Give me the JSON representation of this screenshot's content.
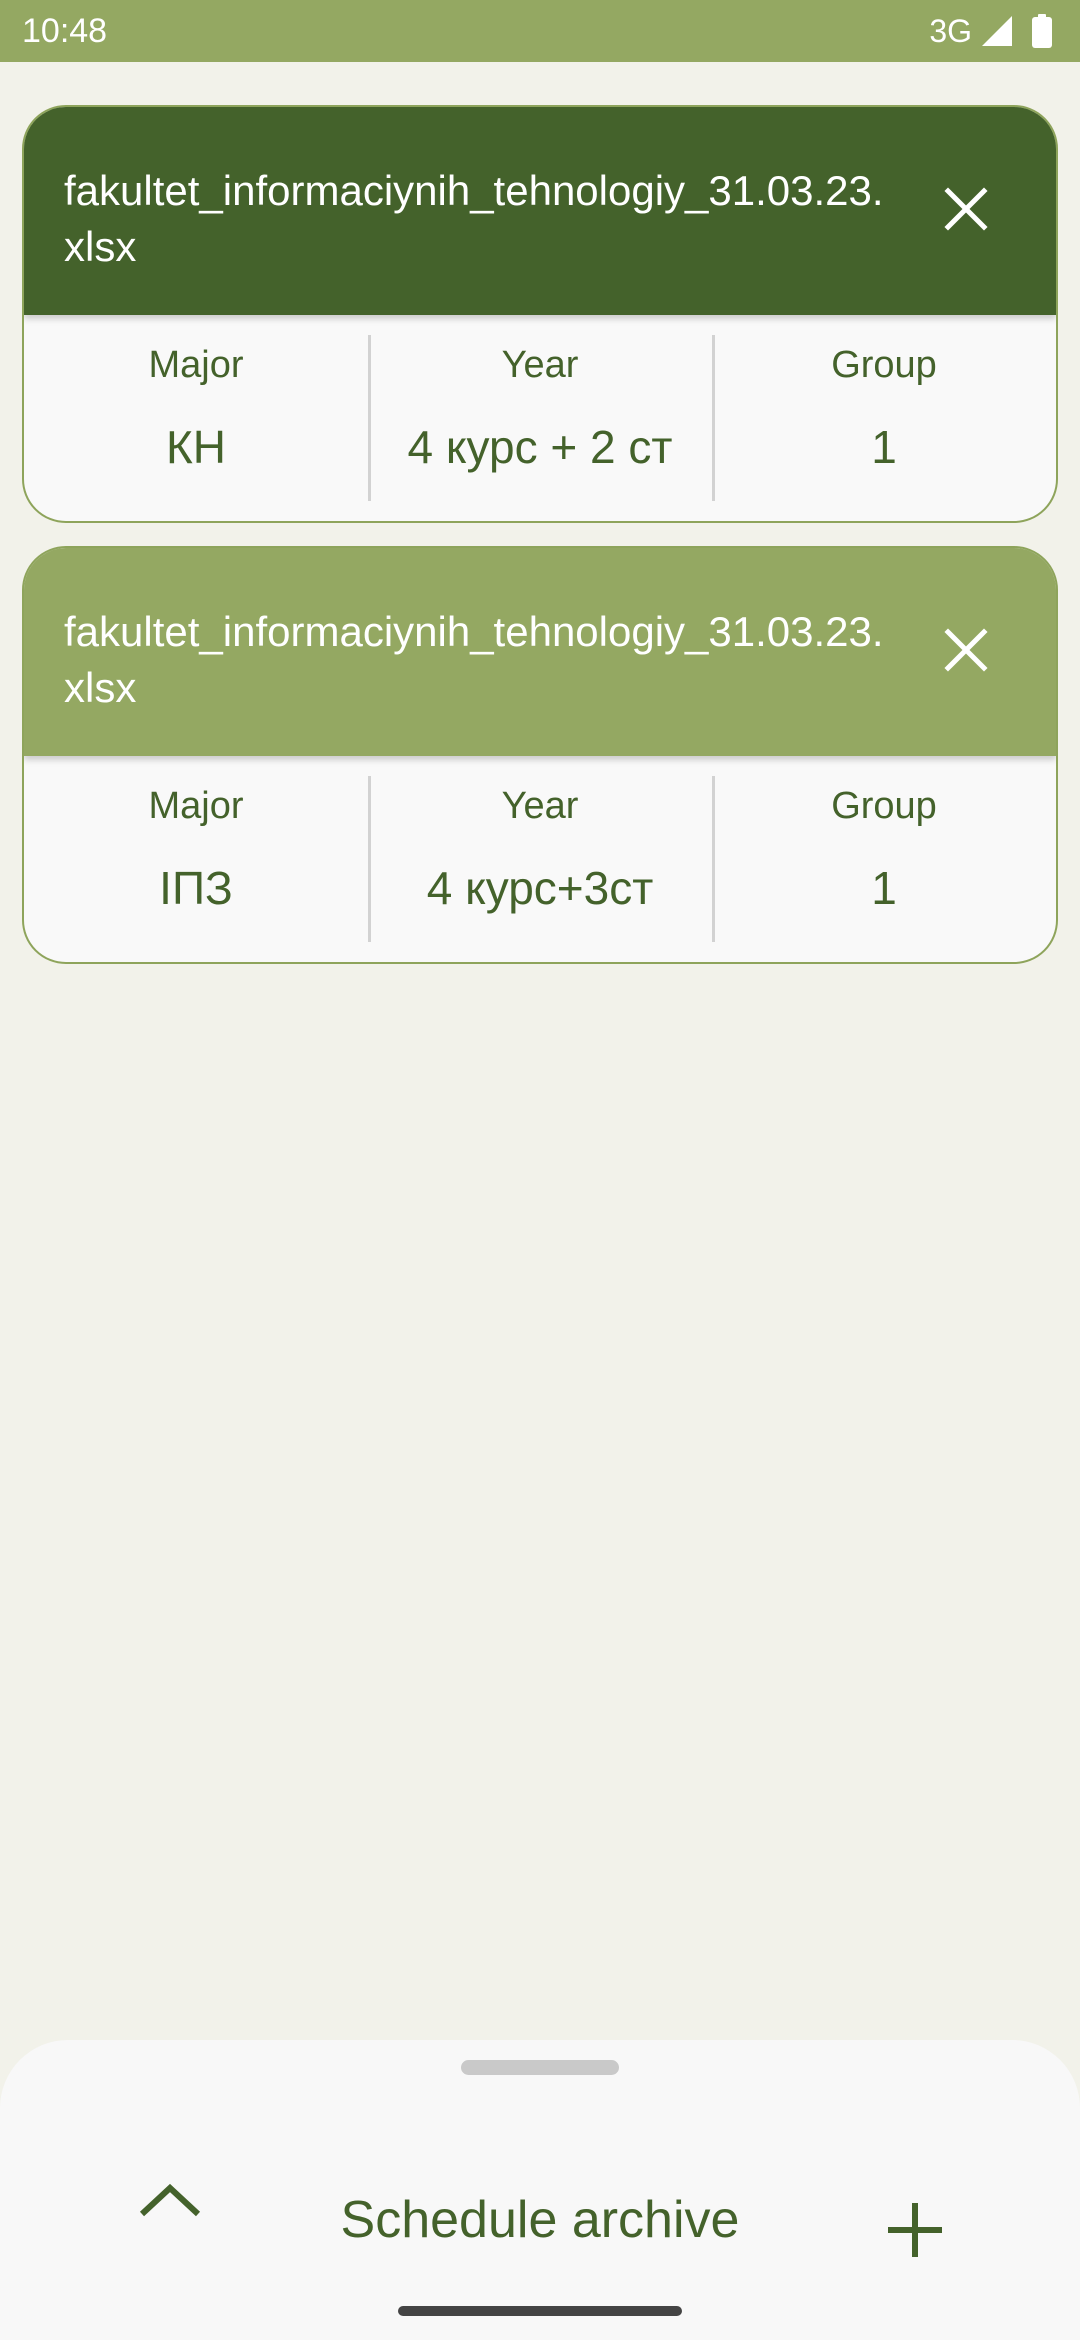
{
  "status_bar": {
    "time": "10:48",
    "network": "3G",
    "signal_icon": "signal-icon",
    "battery_icon": "battery-icon"
  },
  "colors": {
    "status_bar": "#94a862",
    "card_header_selected": "#44622b",
    "card_header": "#94a862",
    "text_primary": "#44622b",
    "background": "#f2f2ea"
  },
  "cards": [
    {
      "file_name": "fakultet_informaciynih_tehnologiy_31.03.23.xlsx",
      "major_label": "Major",
      "major": "КН",
      "year_label": "Year",
      "year": "4 курс + 2 ст",
      "group_label": "Group",
      "group": "1",
      "close_icon": "close-icon"
    },
    {
      "file_name": "fakultet_informaciynih_tehnologiy_31.03.23.xlsx",
      "major_label": "Major",
      "major": "ІПЗ",
      "year_label": "Year",
      "year": "4 курс+3ст",
      "group_label": "Group",
      "group": "1",
      "close_icon": "close-icon"
    }
  ],
  "bottom_sheet": {
    "title": "Schedule archive",
    "expand_icon": "chevron-up-icon",
    "add_icon": "plus-icon"
  }
}
